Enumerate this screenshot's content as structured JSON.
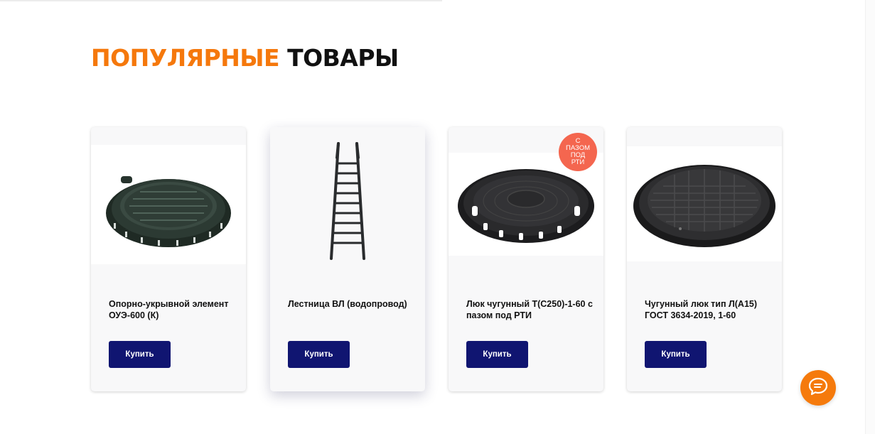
{
  "section": {
    "title_accent": "ПОПУЛЯРНЫЕ",
    "title_rest": "ТОВАРЫ"
  },
  "products": [
    {
      "name": "Опорно-укрывной элемент ОУЭ-600 (К)",
      "buy_label": "Купить",
      "image_icon": "manhole-support-element-image"
    },
    {
      "name": "Лестница ВЛ (водопровод)",
      "buy_label": "Купить",
      "image_icon": "ladder-image"
    },
    {
      "name": "Люк чугунный Т(С250)-1-60 с пазом под РТИ",
      "buy_label": "Купить",
      "image_icon": "manhole-cover-image",
      "badge": "С ПАЗОМ ПОД РТИ"
    },
    {
      "name": "Чугунный люк тип Л(А15) ГОСТ 3634-2019, 1-60",
      "buy_label": "Купить",
      "image_icon": "light-manhole-cover-image"
    }
  ],
  "colors": {
    "accent": "#f5780c",
    "button": "#101571",
    "badge": "#f4664f",
    "chat": "#f57a0c"
  },
  "chat": {
    "icon": "chat-icon"
  }
}
